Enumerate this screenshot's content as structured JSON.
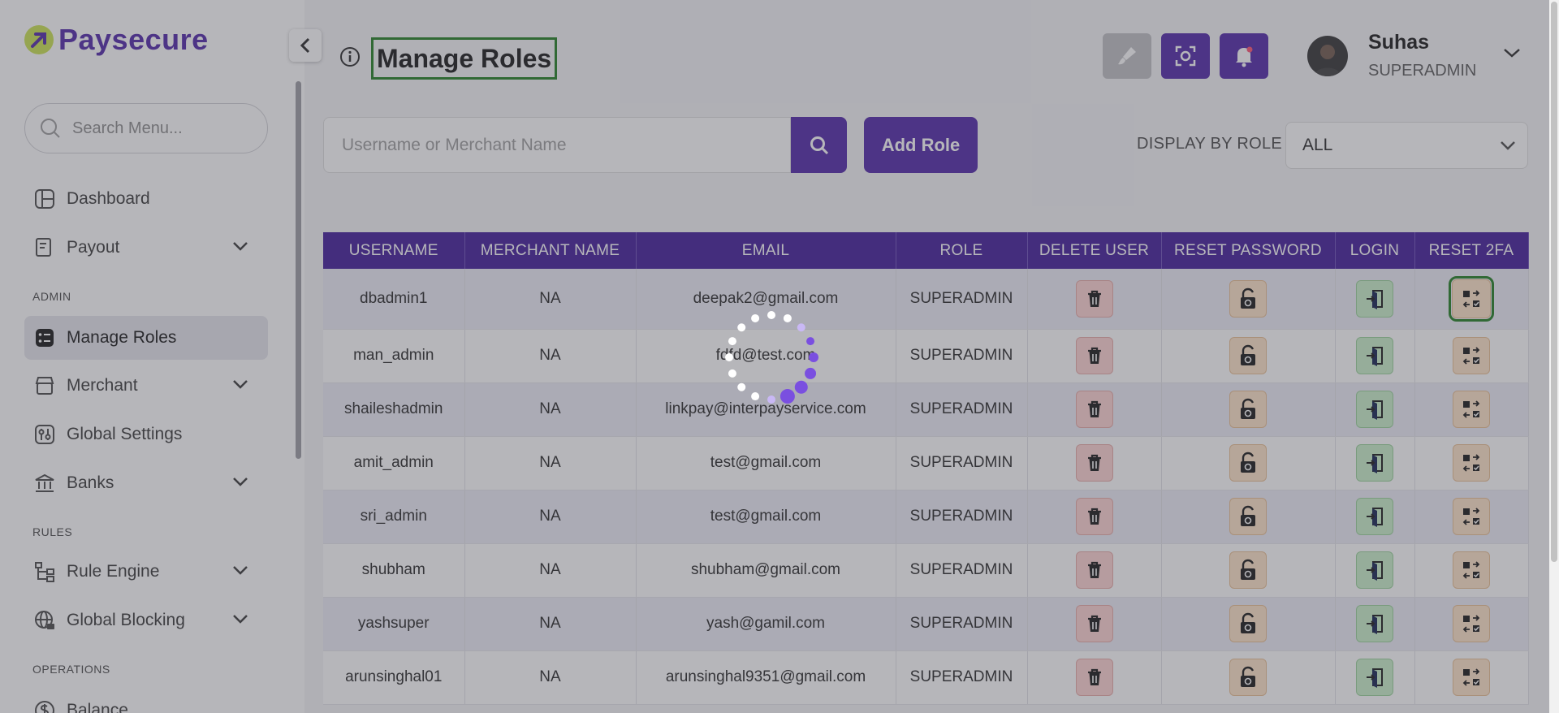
{
  "app": {
    "name": "Paysecure"
  },
  "sidebar": {
    "search_placeholder": "Search Menu...",
    "sections": {
      "admin": "ADMIN",
      "rules": "RULES",
      "operations": "OPERATIONS"
    },
    "items": [
      {
        "label": "Dashboard"
      },
      {
        "label": "Payout"
      },
      {
        "label": "Manage Roles"
      },
      {
        "label": "Merchant"
      },
      {
        "label": "Global Settings"
      },
      {
        "label": "Banks"
      },
      {
        "label": "Rule Engine"
      },
      {
        "label": "Global Blocking"
      },
      {
        "label": "Balance"
      }
    ]
  },
  "header": {
    "title": "Manage Roles",
    "user": {
      "name": "Suhas",
      "role": "SUPERADMIN"
    }
  },
  "toolbar": {
    "search_placeholder": "Username or Merchant Name",
    "add_role_label": "Add Role",
    "display_by_role_label": "DISPLAY BY ROLE",
    "role_filter_value": "ALL"
  },
  "table": {
    "columns": [
      "USERNAME",
      "MERCHANT NAME",
      "EMAIL",
      "ROLE",
      "DELETE USER",
      "RESET PASSWORD",
      "LOGIN",
      "RESET 2FA"
    ],
    "rows": [
      {
        "username": "dbadmin1",
        "merchant": "NA",
        "email": "deepak2@gmail.com",
        "role": "SUPERADMIN"
      },
      {
        "username": "man_admin",
        "merchant": "NA",
        "email": "fdfd@test.com",
        "role": "SUPERADMIN"
      },
      {
        "username": "shaileshadmin",
        "merchant": "NA",
        "email": "linkpay@interpayservice.com",
        "role": "SUPERADMIN"
      },
      {
        "username": "amit_admin",
        "merchant": "NA",
        "email": "test@gmail.com",
        "role": "SUPERADMIN"
      },
      {
        "username": "sri_admin",
        "merchant": "NA",
        "email": "test@gmail.com",
        "role": "SUPERADMIN"
      },
      {
        "username": "shubham",
        "merchant": "NA",
        "email": "shubham@gmail.com",
        "role": "SUPERADMIN"
      },
      {
        "username": "yashsuper",
        "merchant": "NA",
        "email": "yash@gamil.com",
        "role": "SUPERADMIN"
      },
      {
        "username": "arunsinghal01",
        "merchant": "NA",
        "email": "arunsinghal9351@gmail.com",
        "role": "SUPERADMIN"
      }
    ]
  },
  "colors": {
    "brand": "#4b1fa5",
    "header_row": "#3c1496",
    "logo_accent": "#c9e24a",
    "focus": "#1a7a1a"
  },
  "icons": {
    "logo": "arrow-logo-icon",
    "collapse": "chevron-left-icon",
    "info": "info-icon",
    "gray_btn": "brush-icon",
    "scan_btn": "scan-icon",
    "notify_btn": "bell-icon",
    "delete": "trash-icon",
    "reset": "unlock-icon",
    "login": "login-icon",
    "twofa": "swap-icon"
  }
}
